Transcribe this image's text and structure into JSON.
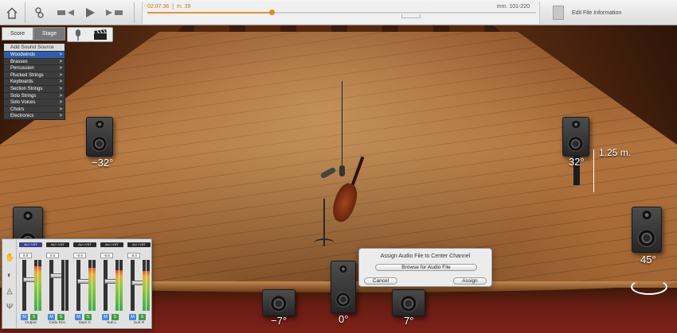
{
  "toolbar": {
    "home_icon": "home-icon",
    "ensemble_icon": "ensemble-icon",
    "rewind_icon": "rewind-icon",
    "play_icon": "play-icon",
    "forward_icon": "forward-icon"
  },
  "timeline": {
    "time": "02:07.36",
    "measure": "m. 39",
    "measure_range": "mm. 101-220",
    "progress": 0.32
  },
  "edit_info": {
    "label": "Edit File Information"
  },
  "view_tabs": [
    {
      "label": "Score",
      "active": false
    },
    {
      "label": "Stage",
      "active": true
    }
  ],
  "view_icons": [
    "microphone-icon",
    "clapperboard-icon"
  ],
  "sound_menu": {
    "header": "Add Sound Source",
    "items": [
      "Woodwinds",
      "Brasses",
      "Percussion",
      "Plucked Strings",
      "Keyboards",
      "Section Strings",
      "Solo Strings",
      "Solo Voices",
      "Choirs",
      "Electronics"
    ],
    "arrow": ">"
  },
  "speakers": {
    "left": "−32°",
    "right": "32°",
    "rear_right": "45°",
    "center_left": "−7°",
    "center": "0°",
    "center_right": "7°"
  },
  "height_label": "1.25 m.",
  "dialog": {
    "title": "Assign Audio File to Center Channel",
    "browse": "Browse for Audio File",
    "cancel": "Cancel",
    "assign": "Assign"
  },
  "mixer": {
    "strips": [
      {
        "plugin": "AU / VST",
        "value": "0.0",
        "label": "Output",
        "fader_level": 0.62,
        "meter_level": 0.88
      },
      {
        "plugin": "AU / VST",
        "value": "0.0",
        "label": "Cello Rec.",
        "fader_level": 0.7,
        "meter_level": 0.0
      },
      {
        "plugin": "AU / VST",
        "value": "-5.6",
        "label": "Main C",
        "fader_level": 0.58,
        "meter_level": 0.85
      },
      {
        "plugin": "AU / VST",
        "value": "-5.6",
        "label": "Sub L",
        "fader_level": 0.58,
        "meter_level": 0.8
      },
      {
        "plugin": "AU / VST",
        "value": "-6.0",
        "label": "Sub R",
        "fader_level": 0.55,
        "meter_level": 0.78
      }
    ],
    "mute": "M",
    "solo": "S"
  },
  "colors": {
    "accent": "#e38a1e",
    "selected_menu": "#2f5dab",
    "mute_button": "#4a87d8",
    "solo_button": "#3f9a44",
    "plugin_badge": "#3b3f8f"
  }
}
